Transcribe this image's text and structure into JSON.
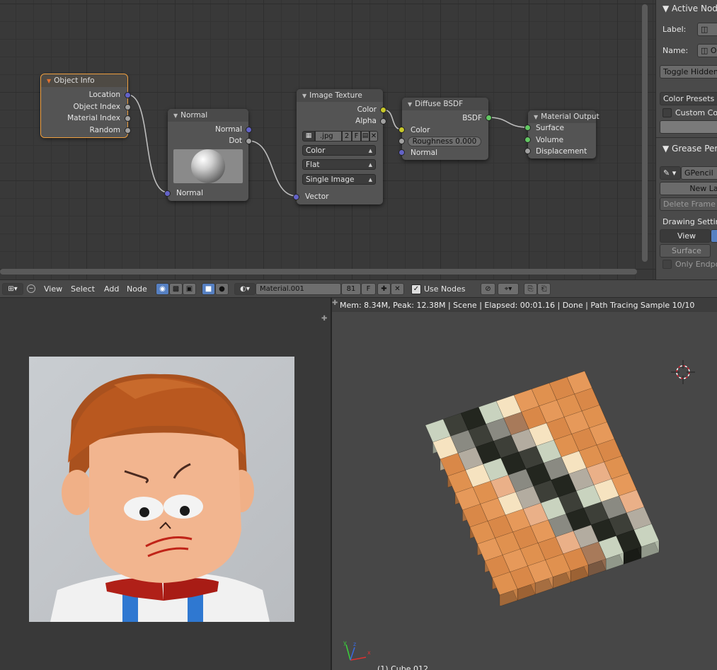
{
  "node_editor": {
    "nodes": {
      "object_info": {
        "title": "Object Info",
        "outputs": [
          "Location",
          "Object Index",
          "Material Index",
          "Random"
        ]
      },
      "normal": {
        "title": "Normal",
        "outputs": [
          "Normal",
          "Dot"
        ],
        "input": "Normal"
      },
      "image_texture": {
        "title": "Image Texture",
        "outputs": [
          "Color",
          "Alpha"
        ],
        "image_name": ".jpg",
        "users": "2",
        "fake_user": "F",
        "color_space": "Color",
        "interpolation": "Flat",
        "source": "Single Image",
        "input": "Vector"
      },
      "diffuse_bsdf": {
        "title": "Diffuse BSDF",
        "output": "BSDF",
        "inputs": [
          "Color",
          "Roughness 0.000",
          "Normal"
        ]
      },
      "material_output": {
        "title": "Material Output",
        "inputs": [
          "Surface",
          "Volume",
          "Displacement"
        ]
      }
    }
  },
  "properties": {
    "active_node_header": "Active Node",
    "label_label": "Label:",
    "name_label": "Name:",
    "name_value": "O",
    "toggle_hidden": "Toggle Hidden N",
    "color_presets": "Color Presets",
    "custom_color": "Custom Colo",
    "grease_pencil_header": "Grease Pen",
    "gpencil_name": "GPencil",
    "new_layer": "New La",
    "delete_frame": "Delete Frame",
    "drawing_settings": "Drawing Setting",
    "view_tab": "View",
    "surface_tab": "Surface",
    "only_endpoints": "Only Endpoi"
  },
  "header": {
    "menus": [
      "View",
      "Select",
      "Add",
      "Node"
    ],
    "material_name": "Material.001",
    "users": "81",
    "fake_user": "F",
    "use_nodes_label": "Use Nodes"
  },
  "viewport": {
    "status": "Mem: 8.34M, Peak: 12.38M | Scene | Elapsed: 00:01.16 | Done | Path Tracing Sample 10/10",
    "object_label": "(1) Cube.012"
  },
  "colors": {
    "accent": "#5680c2",
    "selected_outline": "#f0a040",
    "vector_socket": "#6363c7",
    "color_socket": "#c7c729",
    "shader_socket": "#63c763"
  }
}
